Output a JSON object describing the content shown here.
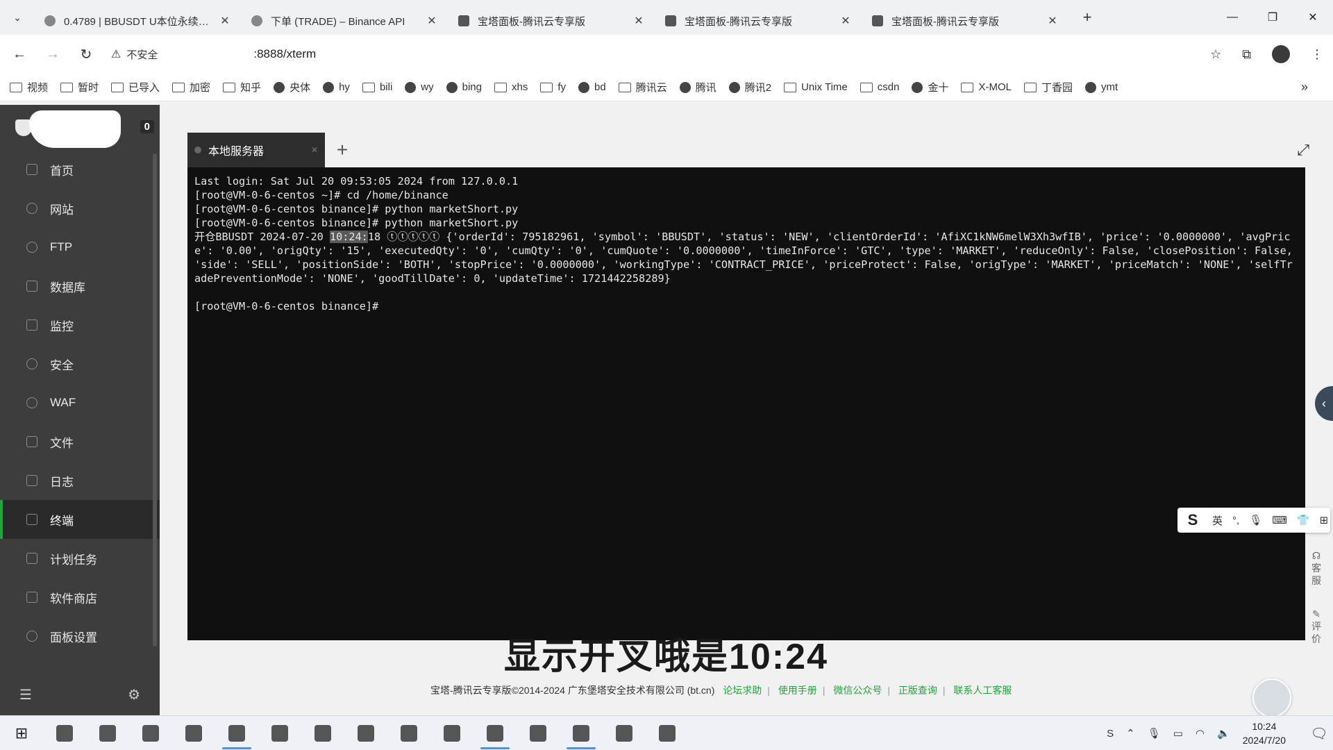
{
  "browser": {
    "tabs": [
      {
        "title": "0.4789 | BBUSDT U本位永续合约",
        "icon": "binance-icon"
      },
      {
        "title": "下单 (TRADE) – Binance API",
        "icon": "gear-icon"
      },
      {
        "title": "宝塔面板-腾讯云专享版",
        "icon": "baota-icon"
      },
      {
        "title": "宝塔面板-腾讯云专享版",
        "icon": "baota-icon"
      },
      {
        "title": "宝塔面板-腾讯云专享版",
        "icon": "baota-icon"
      }
    ],
    "security_label": "不安全",
    "url": ":8888/xterm",
    "bookmarks": [
      "视频",
      "暂时",
      "已导入",
      "加密",
      "知乎",
      "央体",
      "hy",
      "bili",
      "wy",
      "bing",
      "xhs",
      "fy",
      "bd",
      "腾讯云",
      "腾讯",
      "腾讯2",
      "Unix Time",
      "csdn",
      "金十",
      "X-MOL",
      "丁香园",
      "ymt"
    ]
  },
  "panel": {
    "badge": "0",
    "nav": [
      {
        "label": "首页",
        "icon": "home-icon"
      },
      {
        "label": "网站",
        "icon": "globe-icon"
      },
      {
        "label": "FTP",
        "icon": "globe-icon"
      },
      {
        "label": "数据库",
        "icon": "database-icon"
      },
      {
        "label": "监控",
        "icon": "monitor-icon"
      },
      {
        "label": "安全",
        "icon": "shield-icon"
      },
      {
        "label": "WAF",
        "icon": "waf-shield-icon"
      },
      {
        "label": "文件",
        "icon": "folder-icon"
      },
      {
        "label": "日志",
        "icon": "log-icon"
      },
      {
        "label": "终端",
        "icon": "terminal-icon"
      },
      {
        "label": "计划任务",
        "icon": "calendar-icon"
      },
      {
        "label": "软件商店",
        "icon": "apps-icon"
      },
      {
        "label": "面板设置",
        "icon": "settings-icon"
      }
    ],
    "active_index": 9
  },
  "terminal": {
    "tab_label": "本地服务器",
    "lines": [
      "Last login: Sat Jul 20 09:53:05 2024 from 127.0.0.1",
      "[root@VM-0-6-centos ~]# cd /home/binance",
      "[root@VM-0-6-centos binance]# python marketShort.py",
      "[root@VM-0-6-centos binance]# python marketShort.py"
    ],
    "order_prefix": "开仓BBUSDT 2024-07-20 ",
    "order_time_hl": "10:24:",
    "order_rest": "18 ⓣⓣⓣⓣⓣ {'orderId': 795182961, 'symbol': 'BBUSDT', 'status': 'NEW', 'clientOrderId': 'AfiXC1kNW6melW3Xh3wfIB', 'price': '0.0000000', 'avgPrice': '0.00', 'origQty': '15', 'executedQty': '0', 'cumQty': '0', 'cumQuote': '0.0000000', 'timeInForce': 'GTC', 'type': 'MARKET', 'reduceOnly': False, 'closePosition': False, 'side': 'SELL', 'positionSide': 'BOTH', 'stopPrice': '0.0000000', 'workingType': 'CONTRACT_PRICE', 'priceProtect': False, 'origType': 'MARKET', 'priceMatch': 'NONE', 'selfTradePreventionMode': 'NONE', 'goodTillDate': 0, 'updateTime': 1721442258289}",
    "prompt": "[root@VM-0-6-centos binance]#"
  },
  "ime": {
    "lang": "英"
  },
  "side_help": {
    "service": "客服",
    "review": "评价"
  },
  "subtitle": "显示开叉哦是10:24",
  "footer": {
    "copyright": "宝塔-腾讯云专享版©2014-2024 广东堡塔安全技术有限公司 (bt.cn)",
    "links": [
      "论坛求助",
      "使用手册",
      "微信公众号",
      "正版查询",
      "联系人工客服"
    ]
  },
  "taskbar": {
    "time": "10:24",
    "date": "2024/7/20"
  }
}
